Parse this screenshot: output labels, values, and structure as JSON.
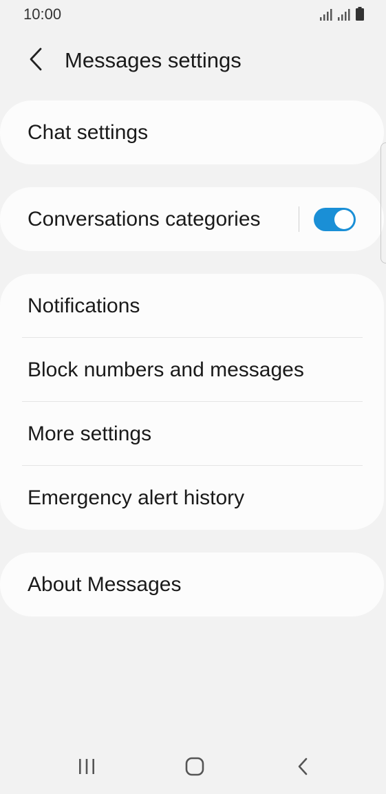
{
  "status_bar": {
    "time": "10:00",
    "icons": [
      "signal-icon",
      "signal-icon",
      "battery-icon"
    ]
  },
  "header": {
    "back_icon": "chevron-left-icon",
    "title": "Messages settings"
  },
  "groups": [
    {
      "items": [
        {
          "label": "Chat settings"
        }
      ]
    },
    {
      "items": [
        {
          "label": "Conversations categories",
          "toggle": true
        }
      ]
    },
    {
      "items": [
        {
          "label": "Notifications"
        },
        {
          "label": "Block numbers and messages"
        },
        {
          "label": "More settings"
        },
        {
          "label": "Emergency alert history"
        }
      ]
    },
    {
      "items": [
        {
          "label": "About Messages"
        }
      ]
    }
  ],
  "colors": {
    "background": "#f2f2f2",
    "card": "#fcfcfc",
    "toggle_on": "#1a8fd6"
  },
  "navbar": {
    "icons": [
      "recent-apps-icon",
      "home-icon",
      "back-icon"
    ]
  }
}
